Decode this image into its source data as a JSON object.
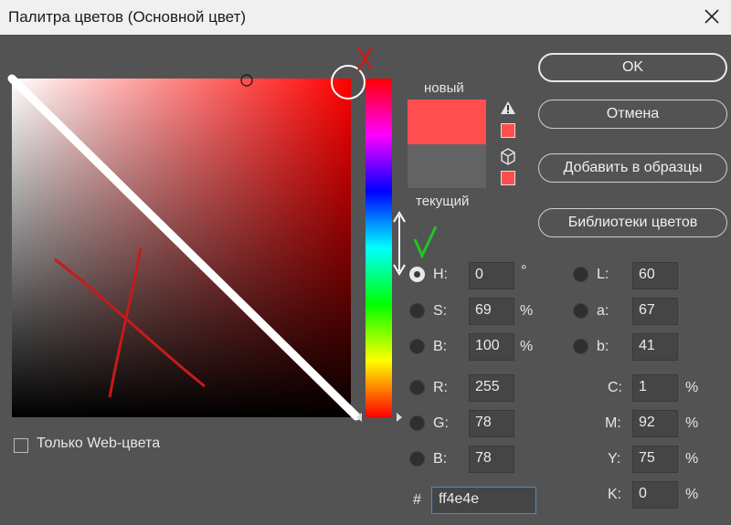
{
  "window": {
    "title": "Палитра цветов (Основной цвет)"
  },
  "preview": {
    "new_label": "новый",
    "current_label": "текущий",
    "new_color": "#ff4e4e",
    "current_color": "#636363"
  },
  "buttons": {
    "ok": "OK",
    "cancel": "Отмена",
    "add_to_swatches": "Добавить в образцы",
    "color_libraries": "Библиотеки цветов"
  },
  "web_only": {
    "label": "Только Web-цвета",
    "checked": false
  },
  "hsb": [
    {
      "label": "H:",
      "value": "0",
      "unit": "°",
      "selected": true
    },
    {
      "label": "S:",
      "value": "69",
      "unit": "%",
      "selected": false
    },
    {
      "label": "B:",
      "value": "100",
      "unit": "%",
      "selected": false
    }
  ],
  "rgb": [
    {
      "label": "R:",
      "value": "255",
      "selected": false
    },
    {
      "label": "G:",
      "value": "78",
      "selected": false
    },
    {
      "label": "B:",
      "value": "78",
      "selected": false
    }
  ],
  "lab": [
    {
      "label": "L:",
      "value": "60",
      "selected": false
    },
    {
      "label": "a:",
      "value": "67",
      "selected": false
    },
    {
      "label": "b:",
      "value": "41",
      "selected": false
    }
  ],
  "cmyk": [
    {
      "label": "C:",
      "value": "1",
      "unit": "%"
    },
    {
      "label": "M:",
      "value": "92",
      "unit": "%"
    },
    {
      "label": "Y:",
      "value": "75",
      "unit": "%"
    },
    {
      "label": "K:",
      "value": "0",
      "unit": "%"
    }
  ],
  "hex": {
    "label": "#",
    "value": "ff4e4e"
  },
  "colors": {
    "dialog_bg": "#535353",
    "titlebar_bg": "#f0f0f0",
    "annotation_red": "#cc1a1a",
    "annotation_green": "#22c422",
    "focus_blue": "#4a8ad0"
  }
}
